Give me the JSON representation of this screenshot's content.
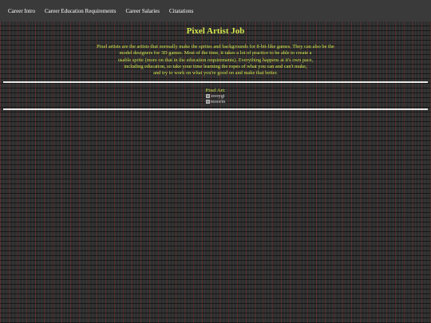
{
  "nav": {
    "items": [
      {
        "label": "Career Intro"
      },
      {
        "label": "Career Education Requirements"
      },
      {
        "label": "Career Salaries"
      },
      {
        "label": "Citatations"
      }
    ]
  },
  "main": {
    "title": "Pixel Artist Job",
    "intro_lines": [
      "Pixel artists are the artists that normally make the sprites and backgrounds for 8-bit-like games. They can also be the",
      "model designers for 3D games. Most of the time, it takes a lot of practice to be able to create a",
      "usable sprite (more on that in the education requirements). Everything happens at it's own pace,",
      "including education, so take your time learning the ropes of what you can and can't make,",
      "and try to work on what you're good on and make that better."
    ]
  },
  "gallery": {
    "label": "Pixel Art:",
    "images": [
      {
        "alt": "zooygi"
      },
      {
        "alt": "moorin"
      }
    ]
  },
  "colors": {
    "accent_text": "#d4e84c",
    "nav_bg": "#3a3a3a",
    "page_bg": "#2e2e2e",
    "divider": "#e8e8e8"
  }
}
